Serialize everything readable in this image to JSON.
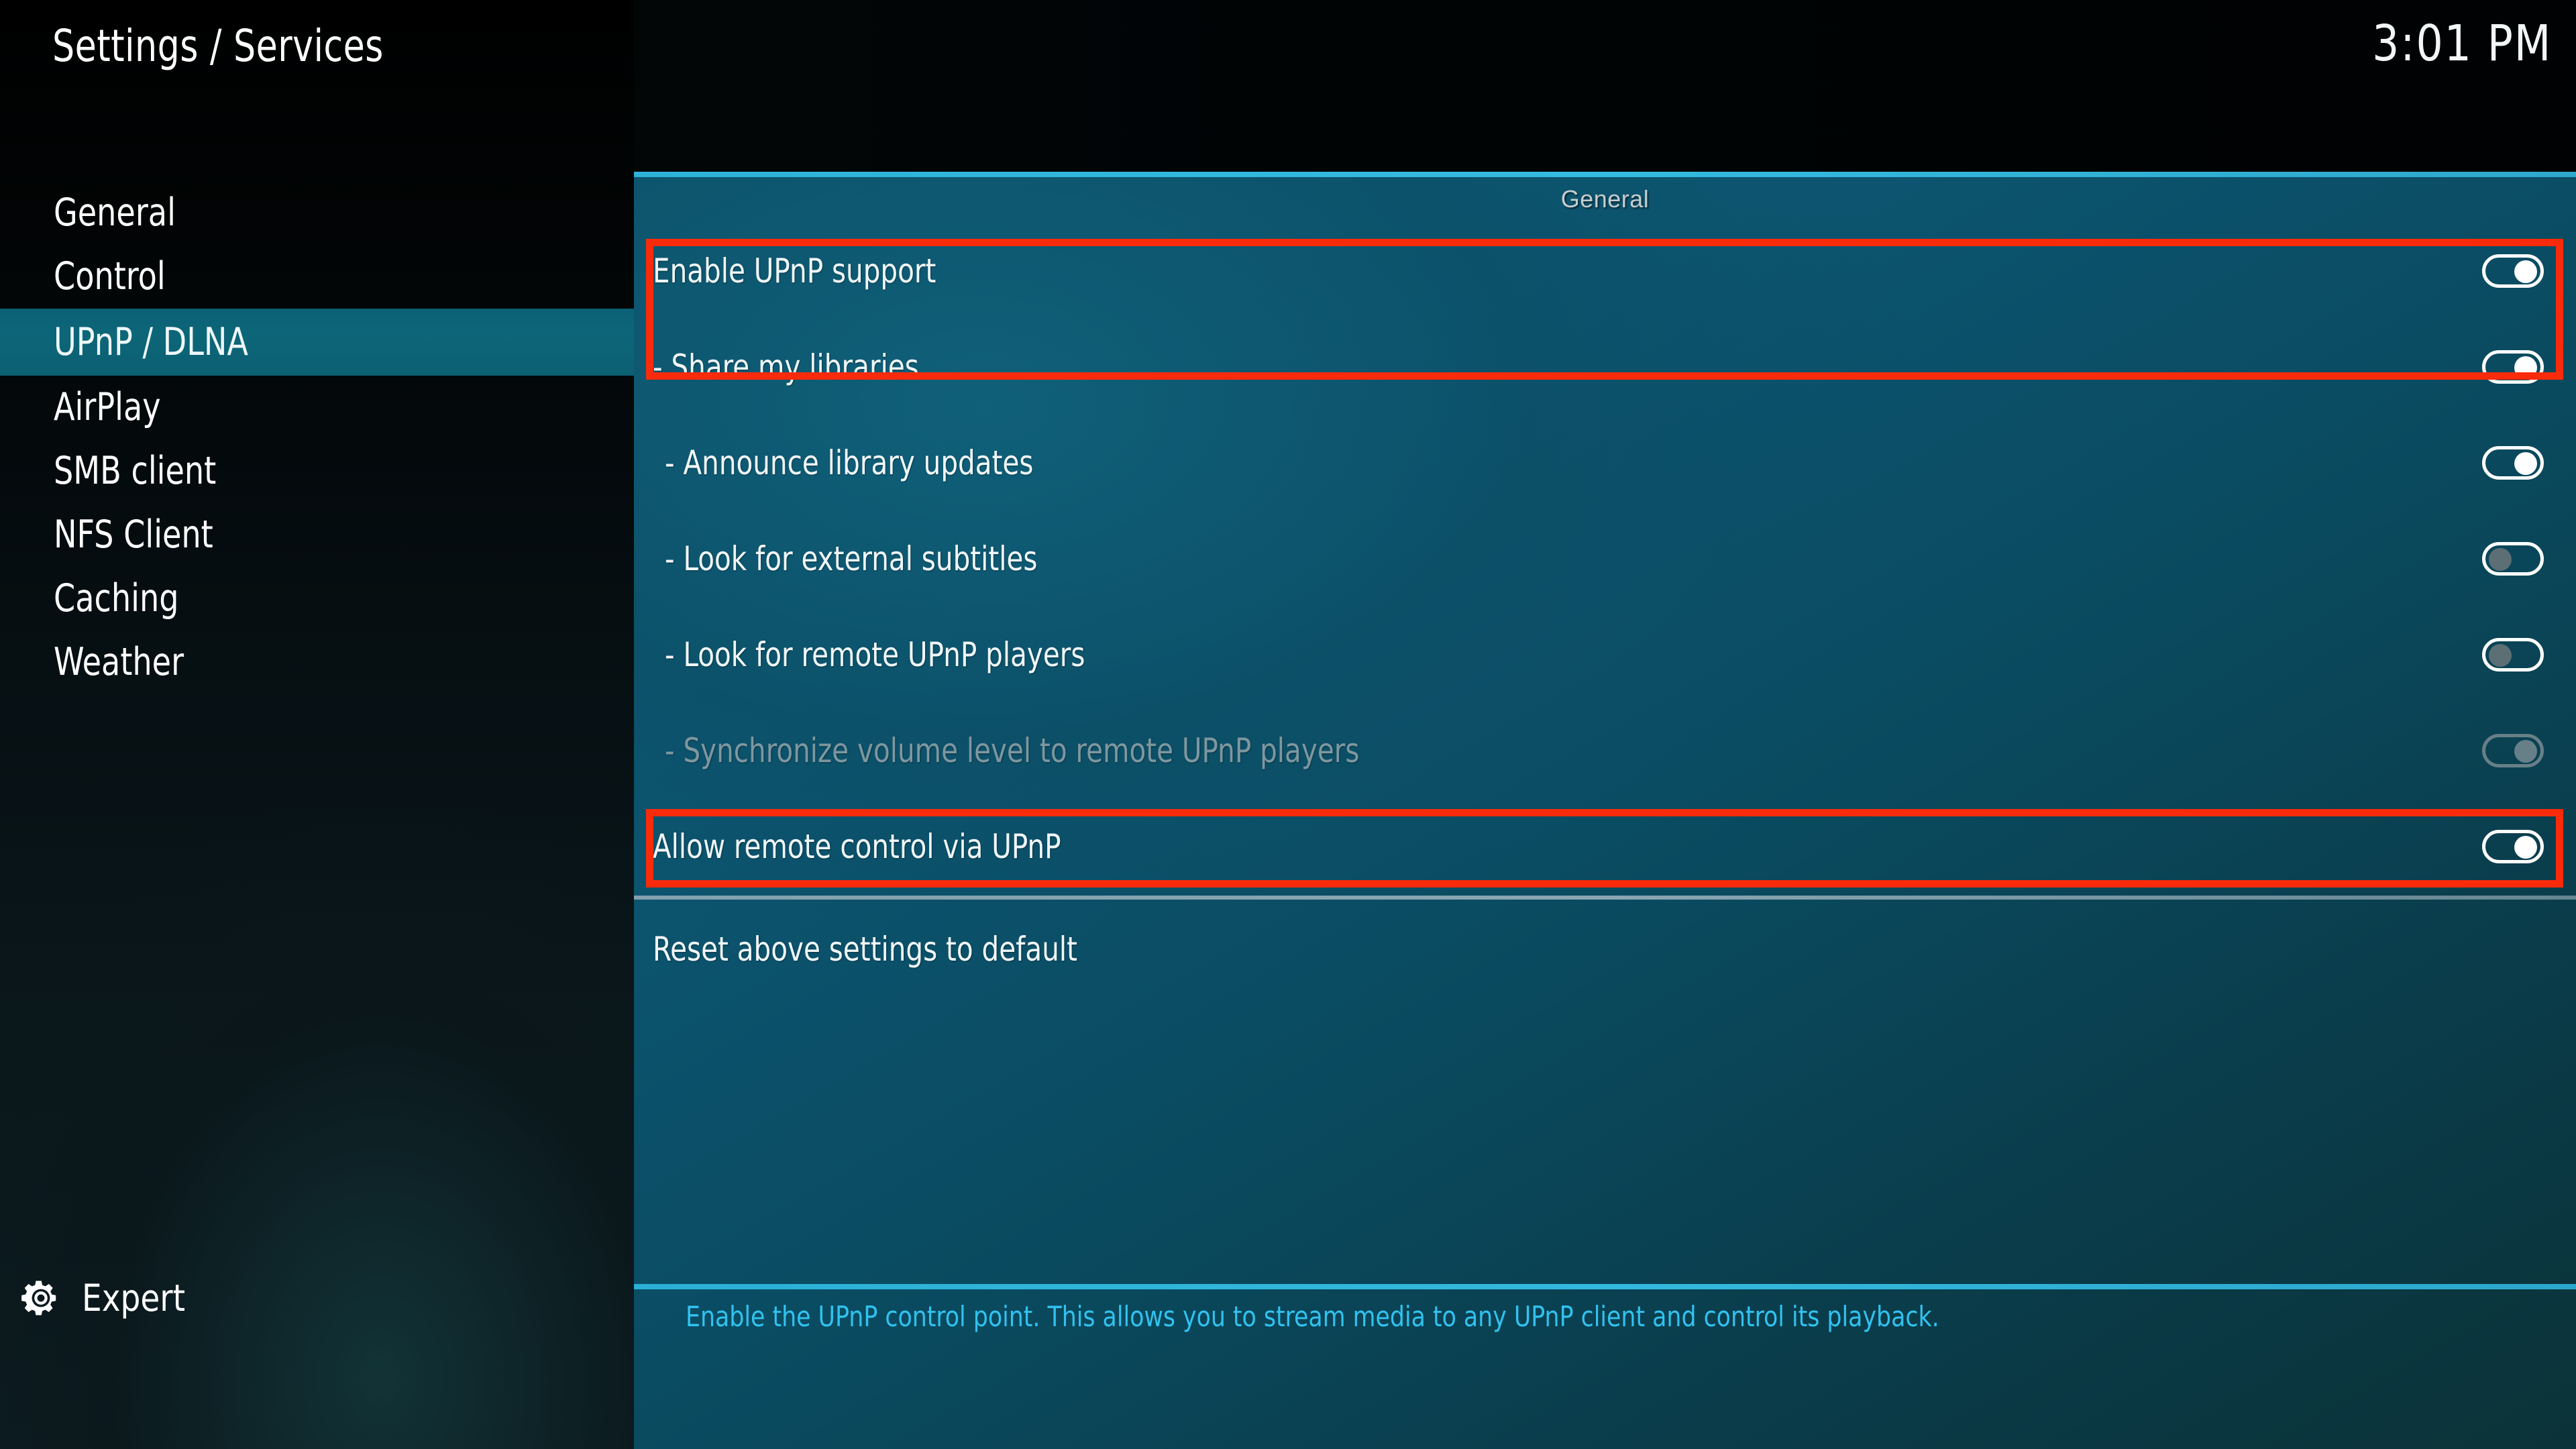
{
  "window": {
    "title": "Settings / Services",
    "clock": "3:01 PM"
  },
  "sidebar": {
    "items": [
      {
        "label": "General",
        "selected": false
      },
      {
        "label": "Control",
        "selected": false
      },
      {
        "label": "UPnP / DLNA",
        "selected": true
      },
      {
        "label": "AirPlay",
        "selected": false
      },
      {
        "label": "SMB client",
        "selected": false
      },
      {
        "label": "NFS Client",
        "selected": false
      },
      {
        "label": "Caching",
        "selected": false
      },
      {
        "label": "Weather",
        "selected": false
      }
    ],
    "level_button": {
      "icon": "gear-icon",
      "label": "Expert"
    }
  },
  "main": {
    "section_header": "General",
    "rows": [
      {
        "label": "Enable UPnP support",
        "control": "toggle",
        "state": "on",
        "enabled": true,
        "indent": 0
      },
      {
        "label": "- Share my libraries",
        "control": "toggle",
        "state": "on",
        "enabled": true,
        "indent": 0
      },
      {
        "label": "- Announce library updates",
        "control": "toggle",
        "state": "on",
        "enabled": true,
        "indent": 1
      },
      {
        "label": "- Look for external subtitles",
        "control": "toggle",
        "state": "off",
        "enabled": true,
        "indent": 1
      },
      {
        "label": "- Look for remote UPnP players",
        "control": "toggle",
        "state": "off",
        "enabled": true,
        "indent": 1
      },
      {
        "label": "- Synchronize volume level to remote UPnP players",
        "control": "toggle",
        "state": "on",
        "enabled": false,
        "indent": 1
      },
      {
        "label": "Allow remote control via UPnP",
        "control": "toggle",
        "state": "on",
        "enabled": true,
        "indent": 0
      },
      {
        "label": "Reset above settings to default",
        "control": "none",
        "state": "",
        "enabled": true,
        "indent": 0
      }
    ],
    "help_text": "Enable the UPnP control point. This allows you to stream media to any UPnP client and control its playback."
  },
  "annotations": {
    "color": "#fa2b0b",
    "boxes": [
      {
        "name": "highlight-enable-and-share",
        "targets": [
          "Enable UPnP support",
          "- Share my libraries"
        ]
      },
      {
        "name": "highlight-allow-remote-control",
        "targets": [
          "Allow remote control via UPnP"
        ]
      }
    ]
  },
  "colors": {
    "accent_teal": "#0d6678",
    "cyan_rule": "#2eb3d8",
    "help_text": "#31c2ef",
    "panel_gradient_from": "#0d5d77",
    "panel_gradient_to": "#0b3238",
    "annotation_red": "#fa2b0b"
  }
}
